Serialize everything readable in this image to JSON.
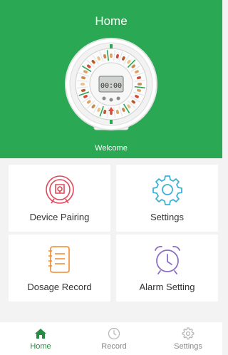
{
  "header": {
    "title": "Home",
    "welcome": "Welcome",
    "background": "#2aa853"
  },
  "device": {
    "clock_display": "00:00"
  },
  "cards": [
    {
      "label": "Device Pairing",
      "icon": "link-lock-icon",
      "color": "#e0485a"
    },
    {
      "label": "Settings",
      "icon": "gear-icon",
      "color": "#3ab0d6"
    },
    {
      "label": "Dosage Record",
      "icon": "notepad-icon",
      "color": "#f08a2c"
    },
    {
      "label": "Alarm Setting",
      "icon": "alarm-clock-icon",
      "color": "#8a6fc4"
    }
  ],
  "tabbar": {
    "items": [
      {
        "label": "Home",
        "icon": "home-icon",
        "active": true
      },
      {
        "label": "Record",
        "icon": "clock-icon",
        "active": false
      },
      {
        "label": "Settings",
        "icon": "gear-icon",
        "active": false
      }
    ],
    "active_color": "#2a8a44"
  }
}
